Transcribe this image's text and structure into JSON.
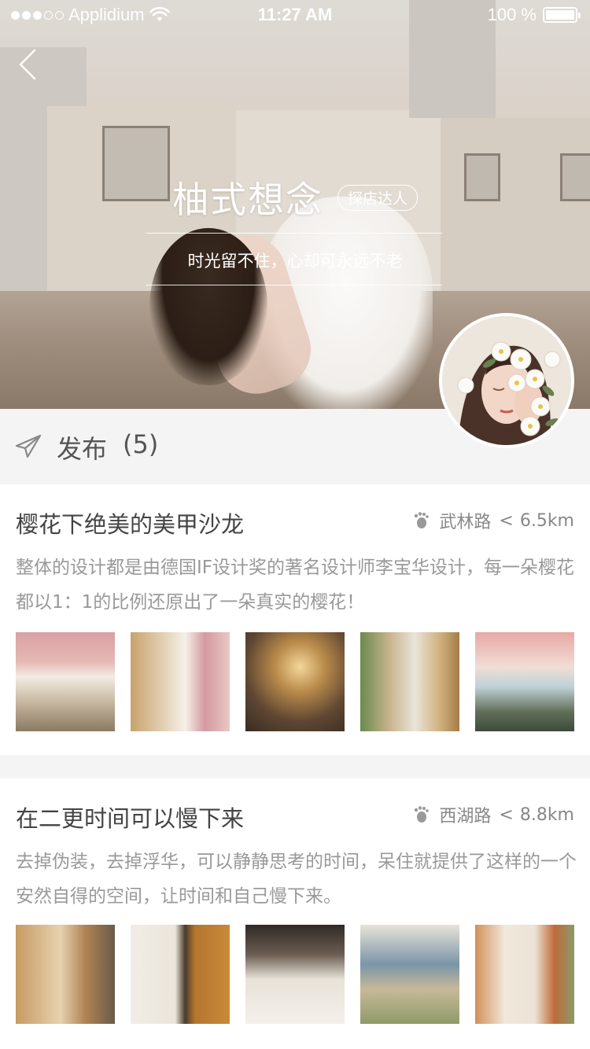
{
  "status_bar": {
    "carrier": "Applidium",
    "time": "11:27 AM",
    "battery": "100 %"
  },
  "hero": {
    "title": "柚式想念",
    "badge": "探店达人",
    "slogan": "时光留不住，心却可永远不老"
  },
  "publish": {
    "label": "发布",
    "count": "(5)"
  },
  "posts": [
    {
      "title": "樱花下绝美的美甲沙龙",
      "location": "武林路",
      "distance_prefix": "<",
      "distance": "6.5km",
      "desc": "整体的设计都是由德国IF设计奖的著名设计师李宝华设计，每一朵樱花都以1：1的比例还原出了一朵真实的樱花！"
    },
    {
      "title": "在二更时间可以慢下来",
      "location": "西湖路",
      "distance_prefix": "<",
      "distance": "8.8km",
      "desc": "去掉伪装，去掉浮华，可以静静思考的时间，呆住就提供了这样的一个安然自得的空间，让时间和自己慢下来。"
    }
  ],
  "colors": {
    "background": "#f4f4f4",
    "card": "#ffffff",
    "title_text": "#444444",
    "secondary_text": "#999999"
  }
}
